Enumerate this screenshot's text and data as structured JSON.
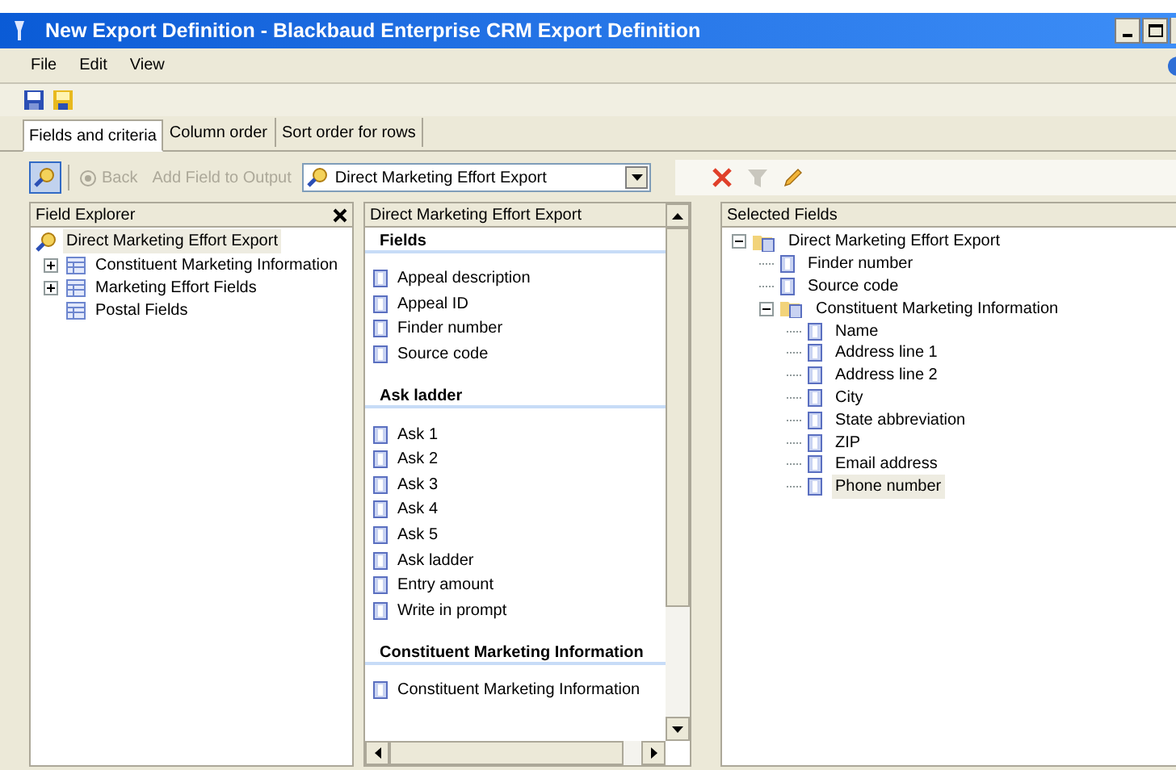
{
  "window": {
    "title": "New Export Definition - Blackbaud Enterprise CRM Export Definition"
  },
  "menu": [
    "File",
    "Edit",
    "View"
  ],
  "tabs": [
    {
      "label": "Fields and criteria",
      "selected": true
    },
    {
      "label": "Column order",
      "selected": false
    },
    {
      "label": "Sort order for rows",
      "selected": false
    }
  ],
  "explorer_toolbar": {
    "back": "Back",
    "add_field": "Add Field to Output",
    "source": "Direct Marketing Effort Export",
    "back_disabled": true,
    "add_disabled": true
  },
  "field_explorer": {
    "title": "Field Explorer",
    "tree": {
      "label": "Direct Marketing Effort Export",
      "selected": true,
      "children": [
        {
          "label": "Constituent Marketing Information",
          "kind": "group",
          "expanded": false
        },
        {
          "label": "Marketing Effort Fields",
          "kind": "group",
          "expanded": false
        },
        {
          "label": "Postal Fields",
          "kind": "leaf"
        }
      ]
    }
  },
  "field_list": {
    "title": "Direct Marketing Effort Export",
    "sections": [
      {
        "heading": "Fields",
        "fields": [
          "Appeal description",
          "Appeal ID",
          "Finder number",
          "Source code"
        ]
      },
      {
        "heading": "Ask ladder",
        "fields": [
          "Ask 1",
          "Ask 2",
          "Ask 3",
          "Ask 4",
          "Ask 5",
          "Ask ladder",
          "Entry amount",
          "Write in prompt"
        ]
      },
      {
        "heading": "Constituent Marketing Information",
        "fields": [
          "Constituent Marketing Information"
        ]
      }
    ]
  },
  "selected_fields": {
    "title": "Selected Fields",
    "tree": {
      "label": "Direct Marketing Effort Export",
      "kind": "folder",
      "expanded": true,
      "selected": false,
      "children": [
        {
          "label": "Finder number",
          "kind": "field",
          "selected": false
        },
        {
          "label": "Source code",
          "kind": "field",
          "selected": false
        },
        {
          "label": "Constituent Marketing Information",
          "kind": "folder",
          "expanded": true,
          "selected": false,
          "children": [
            {
              "label": "Name",
              "kind": "field",
              "selected": false
            },
            {
              "label": "Address line 1",
              "kind": "field",
              "selected": false
            },
            {
              "label": "Address line 2",
              "kind": "field",
              "selected": false
            },
            {
              "label": "City",
              "kind": "field",
              "selected": false
            },
            {
              "label": "State abbreviation",
              "kind": "field",
              "selected": false
            },
            {
              "label": "ZIP",
              "kind": "field",
              "selected": false
            },
            {
              "label": "Email address",
              "kind": "field",
              "selected": false
            },
            {
              "label": "Phone number",
              "kind": "field",
              "selected": true
            }
          ]
        }
      ]
    }
  }
}
